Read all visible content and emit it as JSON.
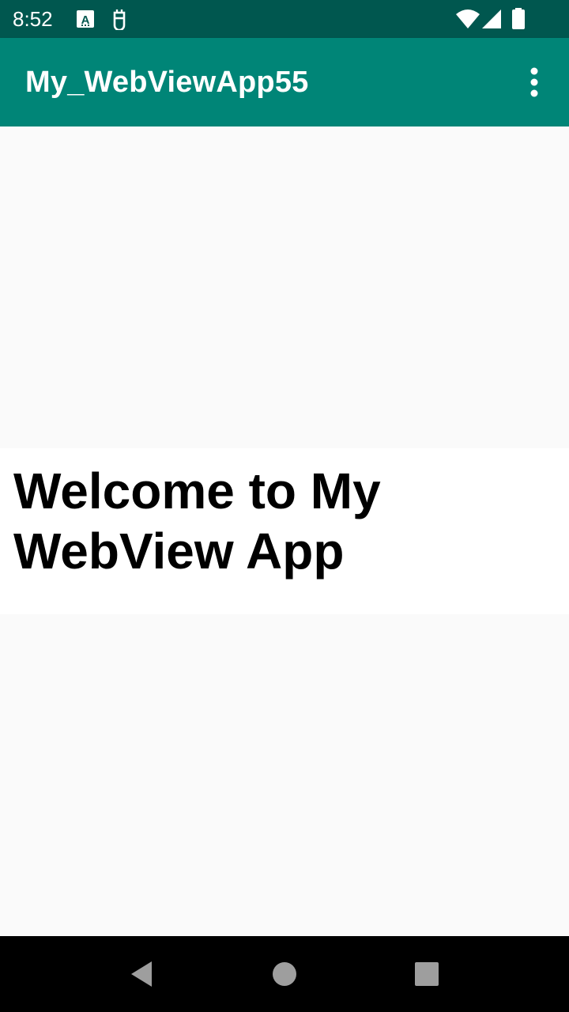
{
  "status_bar": {
    "time": "8:52",
    "icons": [
      "a-badge-icon",
      "bot-icon",
      "wifi-icon",
      "signal-icon",
      "battery-icon"
    ],
    "background": "#00574f"
  },
  "app_bar": {
    "title": "My_WebViewApp55",
    "overflow_icon": "more-vert-icon",
    "background": "#008577"
  },
  "webview": {
    "heading": "Welcome to My WebView App",
    "background": "#fafafa",
    "panel_background": "#ffffff"
  },
  "nav_bar": {
    "buttons": [
      "back-icon",
      "home-icon",
      "recents-icon"
    ],
    "background": "#000000"
  }
}
